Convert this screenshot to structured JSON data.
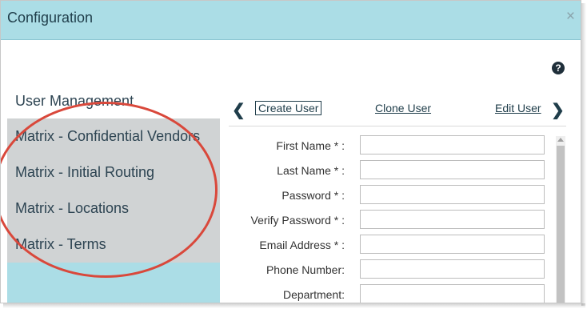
{
  "dialog": {
    "title": "Configuration",
    "close_symbol": "×"
  },
  "help": {
    "symbol": "?"
  },
  "nav": {
    "items": [
      {
        "label": "User Management"
      },
      {
        "label": "Matrix - Confidential Vendors"
      },
      {
        "label": "Matrix - Initial Routing"
      },
      {
        "label": "Matrix - Locations"
      },
      {
        "label": "Matrix - Terms"
      },
      {
        "label": ""
      }
    ]
  },
  "tabs": {
    "prev_symbol": "❮",
    "next_symbol": "❯",
    "items": [
      {
        "label": "Create User",
        "active": true
      },
      {
        "label": "Clone User",
        "active": false
      },
      {
        "label": "Edit User",
        "active": false
      }
    ]
  },
  "form": {
    "fields": [
      {
        "label": "First Name * :",
        "value": ""
      },
      {
        "label": "Last Name * :",
        "value": ""
      },
      {
        "label": "Password * :",
        "value": ""
      },
      {
        "label": "Verify Password * :",
        "value": ""
      },
      {
        "label": "Email Address * :",
        "value": ""
      },
      {
        "label": "Phone Number:",
        "value": ""
      },
      {
        "label": "Department:",
        "value": ""
      }
    ]
  },
  "colors": {
    "title_bar": "#abdde6",
    "nav_item_bg": "#d0d3d4",
    "annotation_ellipse": "#d9483b"
  }
}
